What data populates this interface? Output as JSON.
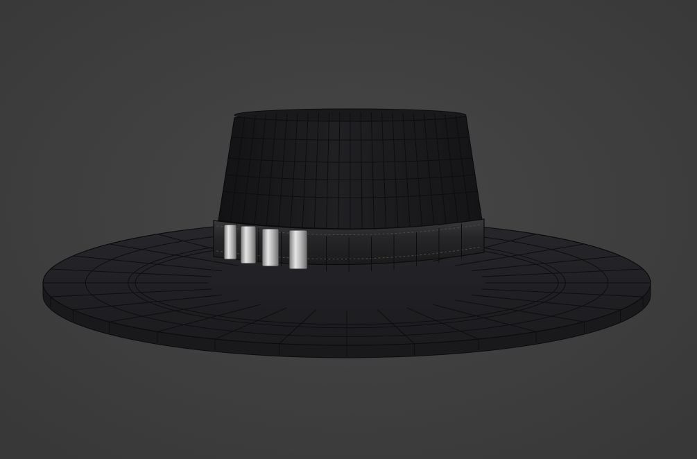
{
  "scene": {
    "subject": "hat-model",
    "background_color": "#3f3f3f",
    "wireframe_color": "#0d0d0f",
    "hat_color": "#1f1f22",
    "band_color": "#2a2a2c",
    "buckle_color": "#c9c9c9",
    "buckle_count": 4,
    "brim_segments": 28,
    "crown_segments": 22
  }
}
